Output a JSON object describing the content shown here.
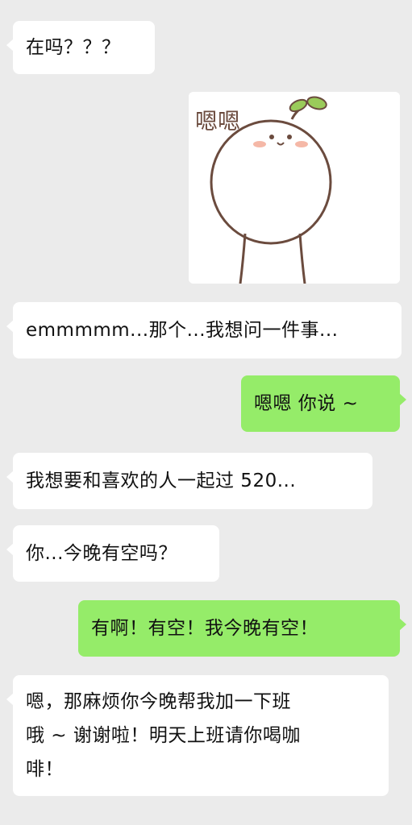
{
  "conversation": {
    "messages": [
      {
        "side": "left",
        "text": "在吗？？？"
      },
      {
        "side": "right",
        "type": "sticker",
        "sticker_text": "嗯嗯",
        "icon": "smiling-sprout-character"
      },
      {
        "side": "left",
        "text": "emmmmm...那个...我想问一件事..."
      },
      {
        "side": "right",
        "text": "嗯嗯 你说 ~"
      },
      {
        "side": "left",
        "text": "我想要和喜欢的人一起过 520..."
      },
      {
        "side": "left",
        "text": "你...今晚有空吗？"
      },
      {
        "side": "right",
        "text": "有啊！有空！我今晚有空！"
      },
      {
        "side": "left",
        "lines": [
          "嗯，那麻烦你今晚帮我加一下班",
          "哦 ~ 谢谢啦！明天上班请你喝咖",
          "啡！"
        ]
      }
    ]
  },
  "colors": {
    "background": "#ebebeb",
    "incoming_bubble": "#ffffff",
    "outgoing_bubble": "#95ec69",
    "text": "#111111"
  }
}
